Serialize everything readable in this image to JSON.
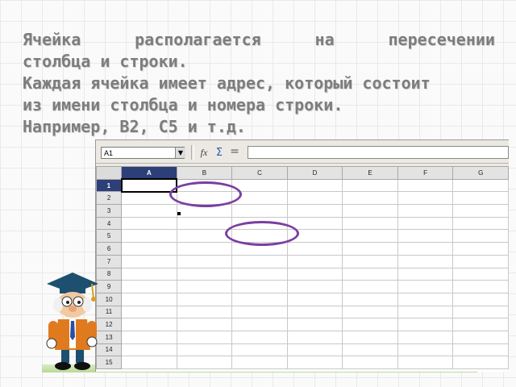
{
  "slide": {
    "line1_words": [
      "Ячейка",
      "располагается",
      "на",
      "пересечении"
    ],
    "line2": "столбца и строки.",
    "line3": "Каждая ячейка имеет адрес, который состоит",
    "line4": "из имени столбца и номера строки.",
    "line5": "Например, В2, С5 и т.д."
  },
  "spreadsheet": {
    "name_box_value": "A1",
    "formula_value": "",
    "icons": {
      "function_wizard": "fx",
      "sum": "Σ",
      "equals": "="
    },
    "columns": [
      "A",
      "B",
      "C",
      "D",
      "E",
      "F",
      "G"
    ],
    "rows": [
      "1",
      "2",
      "3",
      "4",
      "5",
      "6",
      "7",
      "8",
      "9",
      "10",
      "11",
      "12",
      "13",
      "14",
      "15"
    ],
    "active_cell": "A1",
    "highlighted_cells": [
      "B2",
      "C5"
    ]
  },
  "colors": {
    "text": "#7d7d7d",
    "highlight_oval": "#7a3fa0",
    "active_header": "#2d3f78"
  }
}
